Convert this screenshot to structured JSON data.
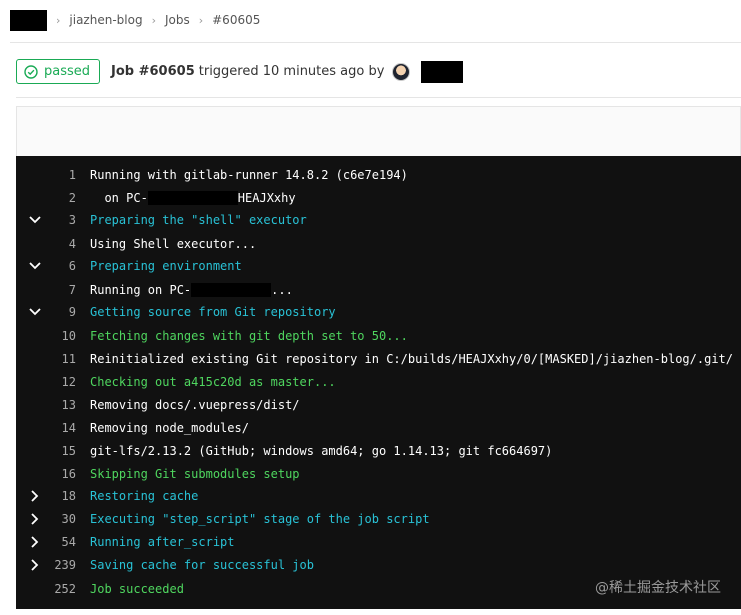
{
  "breadcrumb": {
    "project": "jiazhen-blog",
    "section": "Jobs",
    "job": "#60605",
    "separator": "›"
  },
  "job": {
    "status": "passed",
    "title": "Job #60605",
    "triggered_text": "triggered 10 minutes ago by"
  },
  "log": {
    "lines": [
      {
        "num": "1",
        "text": "Running with gitlab-runner 14.8.2 (c6e7e194)",
        "color": "white",
        "toggle": ""
      },
      {
        "num": "2",
        "text_before": "  on PC-",
        "text_after": "HEAJXxhy",
        "color": "white",
        "toggle": ""
      },
      {
        "num": "3",
        "text": "Preparing the \"shell\" executor",
        "color": "cyan",
        "toggle": "down"
      },
      {
        "num": "4",
        "text": "Using Shell executor...",
        "color": "white",
        "toggle": ""
      },
      {
        "num": "6",
        "text": "Preparing environment",
        "color": "cyan",
        "toggle": "down"
      },
      {
        "num": "7",
        "text_before": "Running on PC-",
        "text_after": "...",
        "color": "white",
        "toggle": ""
      },
      {
        "num": "9",
        "text": "Getting source from Git repository",
        "color": "cyan",
        "toggle": "down"
      },
      {
        "num": "10",
        "text": "Fetching changes with git depth set to 50...",
        "color": "green",
        "toggle": ""
      },
      {
        "num": "11",
        "text": "Reinitialized existing Git repository in C:/builds/HEAJXxhy/0/[MASKED]/jiazhen-blog/.git/",
        "color": "white",
        "toggle": ""
      },
      {
        "num": "12",
        "text": "Checking out a415c20d as master...",
        "color": "green",
        "toggle": ""
      },
      {
        "num": "13",
        "text": "Removing docs/.vuepress/dist/",
        "color": "white",
        "toggle": ""
      },
      {
        "num": "14",
        "text": "Removing node_modules/",
        "color": "white",
        "toggle": ""
      },
      {
        "num": "15",
        "text": "git-lfs/2.13.2 (GitHub; windows amd64; go 1.14.13; git fc664697)",
        "color": "white",
        "toggle": ""
      },
      {
        "num": "16",
        "text": "Skipping Git submodules setup",
        "color": "green",
        "toggle": ""
      },
      {
        "num": "18",
        "text": "Restoring cache",
        "color": "cyan",
        "toggle": "right"
      },
      {
        "num": "30",
        "text": "Executing \"step_script\" stage of the job script",
        "color": "cyan",
        "toggle": "right"
      },
      {
        "num": "54",
        "text": "Running after_script",
        "color": "cyan",
        "toggle": "right"
      },
      {
        "num": "239",
        "text": "Saving cache for successful job",
        "color": "cyan",
        "toggle": "right"
      },
      {
        "num": "252",
        "text": "Job succeeded",
        "color": "green",
        "toggle": ""
      }
    ]
  },
  "watermark": "@稀土掘金技术社区",
  "colors": {
    "success": "#1aaa55",
    "log_background": "#111111",
    "log_cyan": "#29c2d6",
    "log_green": "#4fd65f"
  }
}
